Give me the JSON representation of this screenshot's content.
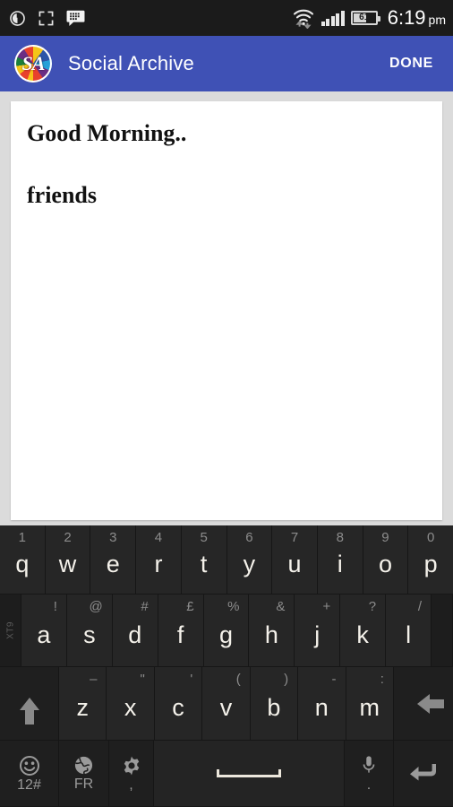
{
  "statusbar": {
    "left_icons": [
      {
        "name": "sync-icon",
        "glyph": "◔"
      },
      {
        "name": "screenshot-icon",
        "glyph": "⬚"
      },
      {
        "name": "bbm-message-icon",
        "glyph": "💬"
      }
    ],
    "wifi_icon": "wifi-data-icon",
    "signal_icon": "cellular-signal-icon",
    "signal_bars": 5,
    "battery": {
      "name": "battery-icon",
      "level": "61",
      "percent": 61
    },
    "time": "6:19",
    "ampm": "pm"
  },
  "appbar": {
    "logo_text": "SA",
    "title": "Social Archive",
    "action_label": "DONE",
    "bg_color": "#3f51b5"
  },
  "note": {
    "lines": [
      "Good Morning..",
      "friends"
    ]
  },
  "keyboard": {
    "row1": [
      {
        "main": "q",
        "alt": "1"
      },
      {
        "main": "w",
        "alt": "2"
      },
      {
        "main": "e",
        "alt": "3"
      },
      {
        "main": "r",
        "alt": "4"
      },
      {
        "main": "t",
        "alt": "5"
      },
      {
        "main": "y",
        "alt": "6"
      },
      {
        "main": "u",
        "alt": "7"
      },
      {
        "main": "i",
        "alt": "8"
      },
      {
        "main": "o",
        "alt": "9"
      },
      {
        "main": "p",
        "alt": "0"
      }
    ],
    "xt9_label": "XT9",
    "row2": [
      {
        "main": "a",
        "alt": "!"
      },
      {
        "main": "s",
        "alt": "@"
      },
      {
        "main": "d",
        "alt": "#"
      },
      {
        "main": "f",
        "alt": "£"
      },
      {
        "main": "g",
        "alt": "%"
      },
      {
        "main": "h",
        "alt": "&"
      },
      {
        "main": "j",
        "alt": "+"
      },
      {
        "main": "k",
        "alt": "?"
      },
      {
        "main": "l",
        "alt": "/"
      }
    ],
    "shift_label": "shift-key",
    "row3": [
      {
        "main": "z",
        "alt": "–"
      },
      {
        "main": "x",
        "alt": "\""
      },
      {
        "main": "c",
        "alt": "'"
      },
      {
        "main": "v",
        "alt": "("
      },
      {
        "main": "b",
        "alt": ")"
      },
      {
        "main": "n",
        "alt": "-"
      },
      {
        "main": "m",
        "alt": ":"
      }
    ],
    "backspace_label": "backspace-key",
    "row4": {
      "symbols_label": "12#",
      "symbols_icon": "emoji-icon",
      "language_label": "FR",
      "language_icon": "globe-icon",
      "settings_label": ",",
      "settings_icon": "gear-icon",
      "space_label": "",
      "mic_label": ".",
      "mic_icon": "microphone-icon",
      "enter_label": "enter-key"
    }
  }
}
